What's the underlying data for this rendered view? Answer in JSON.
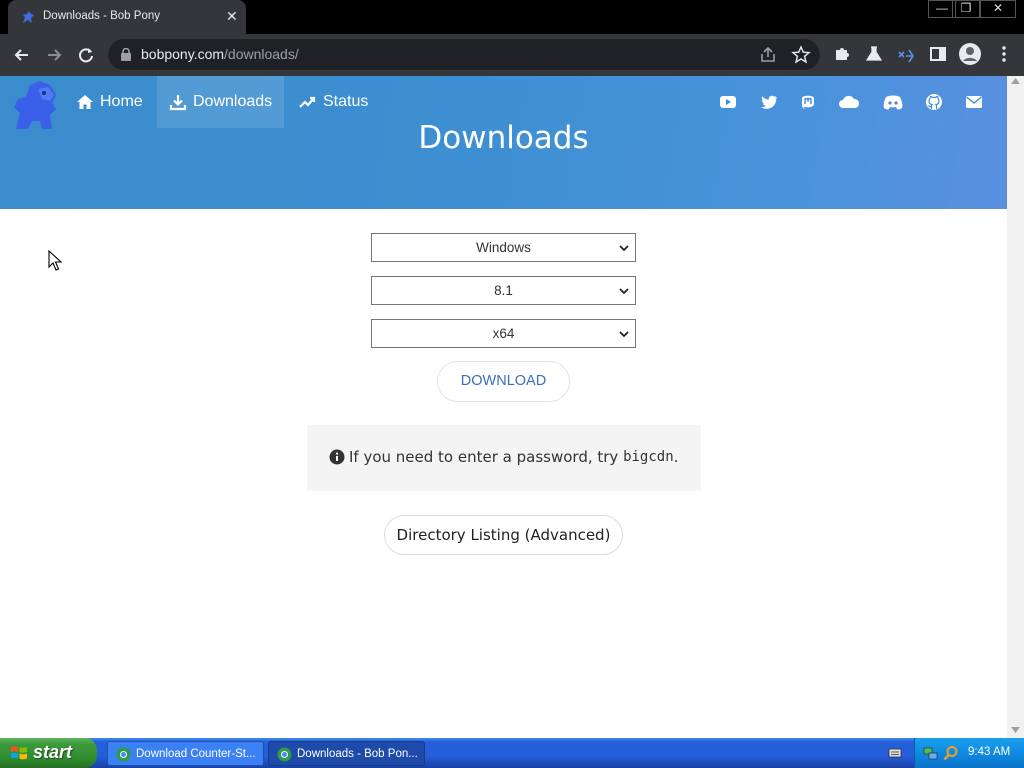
{
  "browser": {
    "tab_title": "Downloads - Bob Pony",
    "tab_close": "✕",
    "window_controls": {
      "minimize": "—",
      "restore": "❐",
      "close": "✕"
    },
    "url_domain": "bobpony.com",
    "url_path": "/downloads/"
  },
  "site": {
    "nav": [
      {
        "label": "Home",
        "icon": "home-icon"
      },
      {
        "label": "Downloads",
        "icon": "download-icon"
      },
      {
        "label": "Status",
        "icon": "trending-up-icon"
      }
    ],
    "social_icons": [
      "youtube-icon",
      "twitter-icon",
      "mastodon-icon",
      "cloud-icon",
      "discord-icon",
      "github-icon",
      "mail-icon"
    ],
    "page_title": "Downloads"
  },
  "form": {
    "os_value": "Windows",
    "version_value": "8.1",
    "arch_value": "x64",
    "download_label": "DOWNLOAD",
    "notice_prefix": "If you need to enter a password, try",
    "notice_code": "bigcdn",
    "notice_suffix": ".",
    "directory_label": "Directory Listing (Advanced)"
  },
  "taskbar": {
    "start_label": "start",
    "tasks": [
      {
        "label": "Download Counter-St..."
      },
      {
        "label": "Downloads - Bob Pon..."
      }
    ],
    "clock": "9:43 AM"
  },
  "colors": {
    "header_gradient_start": "#3a8ccc",
    "header_gradient_end": "#5a8fe0",
    "download_text": "#3a6fb8",
    "chrome_dark": "#35363a"
  }
}
